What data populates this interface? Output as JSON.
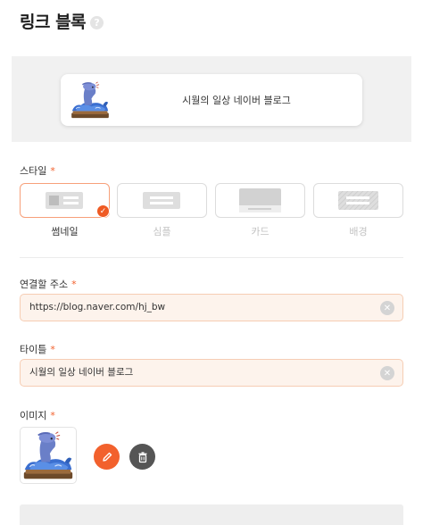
{
  "header": {
    "title": "링크 블록",
    "help_icon": "question-mark-icon"
  },
  "preview": {
    "text": "시월의 일상 네이버 블로그",
    "thumbnail": "blue-whale-illustration"
  },
  "style_section": {
    "label": "스타일",
    "required_mark": "*",
    "options": [
      {
        "name": "썸네일",
        "icon": "thumbnail-layout-icon",
        "selected": true
      },
      {
        "name": "심플",
        "icon": "simple-layout-icon",
        "selected": false
      },
      {
        "name": "카드",
        "icon": "card-layout-icon",
        "selected": false
      },
      {
        "name": "배경",
        "icon": "background-layout-icon",
        "selected": false
      }
    ]
  },
  "url_field": {
    "label": "연결할 주소",
    "required_mark": "*",
    "value": "https://blog.naver.com/hj_bw"
  },
  "title_field": {
    "label": "타이틀",
    "required_mark": "*",
    "value": "시월의 일상 네이버 블로그"
  },
  "image_section": {
    "label": "이미지",
    "required_mark": "*"
  },
  "colors": {
    "accent": "#f2612d",
    "field_bg": "#fdf3ec",
    "field_border": "#f6cdb4",
    "preview_bg": "#f1f1f1"
  }
}
